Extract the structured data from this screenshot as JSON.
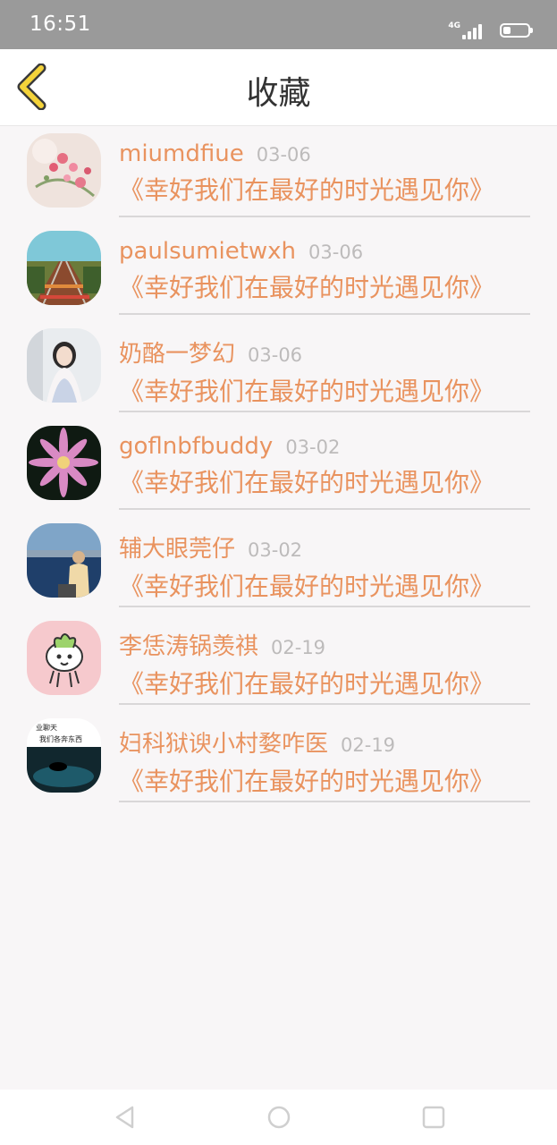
{
  "status_bar": {
    "time": "16:51",
    "network": "4G"
  },
  "header": {
    "title": "收藏"
  },
  "favorites": [
    {
      "name": "miumdfiue",
      "date": "03-06",
      "title": "《幸好我们在最好的时光遇见你》"
    },
    {
      "name": "paulsumietwxh",
      "date": "03-06",
      "title": "《幸好我们在最好的时光遇见你》"
    },
    {
      "name": "奶酪一梦幻",
      "date": "03-06",
      "title": "《幸好我们在最好的时光遇见你》"
    },
    {
      "name": "goflnbfbuddy",
      "date": "03-02",
      "title": "《幸好我们在最好的时光遇见你》"
    },
    {
      "name": "辅大眼莞仔",
      "date": "03-02",
      "title": "《幸好我们在最好的时光遇见你》"
    },
    {
      "name": "李恁涛锅羡祺",
      "date": "02-19",
      "title": "《幸好我们在最好的时光遇见你》"
    },
    {
      "name": "妇科狱谀小村婺咋医",
      "date": "02-19",
      "title": "《幸好我们在最好的时光遇见你》"
    }
  ],
  "avatar7_text": {
    "line1": "业聊天",
    "line2": "我们各奔东西"
  },
  "colors": {
    "accent": "#e9935f",
    "back_arrow": "#f4d33a",
    "status_bar": "#9a9a9a"
  }
}
